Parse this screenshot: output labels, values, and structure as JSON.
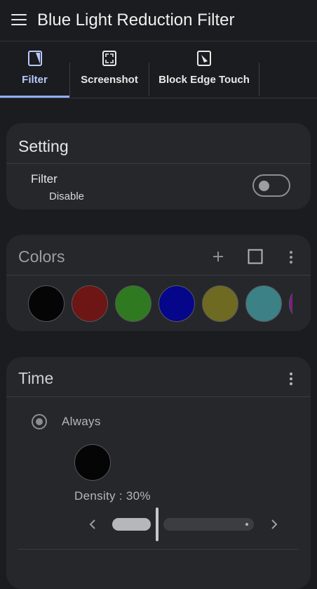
{
  "app": {
    "title": "Blue Light Reduction Filter"
  },
  "tabs": [
    {
      "label": "Filter",
      "icon": "filter-icon"
    },
    {
      "label": "Screenshot",
      "icon": "screenshot-icon"
    },
    {
      "label": "Block Edge Touch",
      "icon": "block-edge-touch-icon"
    }
  ],
  "setting_card": {
    "title": "Setting",
    "filter_label": "Filter",
    "filter_status": "Disable",
    "filter_enabled": false
  },
  "colors_card": {
    "title": "Colors",
    "swatches": [
      "#050505",
      "#6e1515",
      "#2f7a20",
      "#06068a",
      "#6f6a22",
      "#3c8185",
      "#7a1f86"
    ]
  },
  "time_card": {
    "title": "Time",
    "mode_label": "Always",
    "preview_color": "#050505",
    "density_label": "Density : 30%",
    "density_value": 30
  },
  "colors": {
    "background": "#1b1c1f",
    "card": "#26272b",
    "accent": "#8fb0ff"
  }
}
